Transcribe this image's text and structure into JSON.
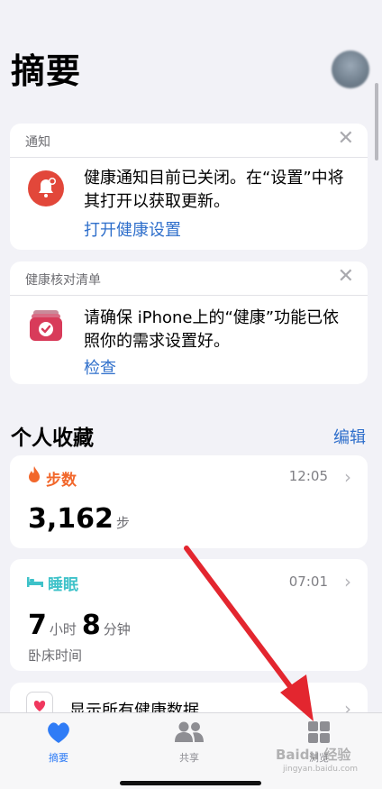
{
  "header": {
    "title": "摘要"
  },
  "notice_card": {
    "title": "通知",
    "message": "健康通知目前已关闭。在“设置”中将其打开以获取更新。",
    "link": "打开健康设置"
  },
  "checklist_card": {
    "title": "健康核对清单",
    "message": "请确保 iPhone上的“健康”功能已依照你的需求设置好。",
    "link": "检查"
  },
  "favorites": {
    "title": "个人收藏",
    "edit": "编辑",
    "steps": {
      "label": "步数",
      "time": "12:05",
      "value": "3,162",
      "unit": "步"
    },
    "sleep": {
      "label": "睡眠",
      "time": "07:01",
      "hours": "7",
      "hours_unit": "小时",
      "minutes": "8",
      "minutes_unit": "分钟",
      "caption": "卧床时间"
    },
    "show_all": "显示所有健康数据"
  },
  "tabs": [
    {
      "label": "摘要",
      "icon": "heart-icon",
      "active": true
    },
    {
      "label": "共享",
      "icon": "people-icon",
      "active": false
    },
    {
      "label": "浏览",
      "icon": "grid-icon",
      "active": false
    }
  ],
  "colors": {
    "accent": "#2f6fcb",
    "steps": "#f2672b",
    "sleep": "#3ec2c9",
    "alert": "#e2473a",
    "arrow": "#e3262f"
  },
  "watermark": {
    "text": "Baidu 经验",
    "sub": "jingyan.baidu.com"
  }
}
